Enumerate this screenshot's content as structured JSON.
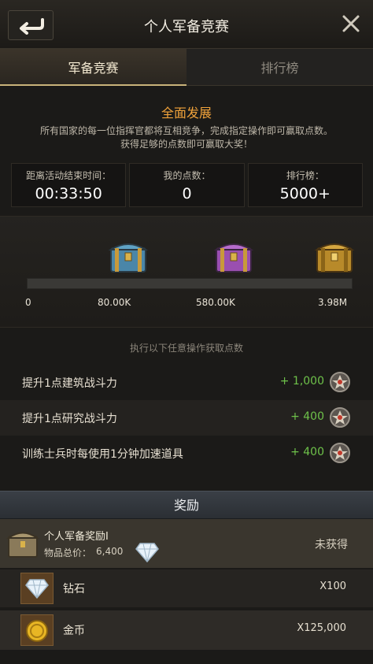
{
  "header": {
    "title": "个人军备竞赛",
    "back_icon": "back-arrow-icon",
    "close_icon": "close-icon"
  },
  "tabs": [
    {
      "label": "军备竞赛",
      "active": true
    },
    {
      "label": "排行榜",
      "active": false
    }
  ],
  "event": {
    "title": "全面发展",
    "description_line1": "所有国家的每一位指挥官都将互相竞争，完成指定操作即可赢取点数。",
    "description_line2": "获得足够的点数即可赢取大奖！"
  },
  "stats": {
    "time_label": "距离活动结束时间：",
    "time_value": "00:33:50",
    "points_label": "我的点数：",
    "points_value": "0",
    "rank_label": "排行榜：",
    "rank_value": "5000+"
  },
  "progress": {
    "fraction": 0,
    "milestones": [
      "0",
      "80.00K",
      "580.00K",
      "3.98M"
    ],
    "chests": [
      {
        "icon": "blue-chest-icon",
        "color": "#4a86a8"
      },
      {
        "icon": "purple-chest-icon",
        "color": "#9a4fb0"
      },
      {
        "icon": "gold-chest-icon",
        "color": "#b88a2a"
      }
    ]
  },
  "tasks": {
    "hint": "执行以下任意操作获取点数",
    "items": [
      {
        "label": "提升1点建筑战斗力",
        "points": "+ 1,000",
        "icon": "medal-badge-icon"
      },
      {
        "label": "提升1点研究战斗力",
        "points": "+ 400",
        "icon": "medal-badge-icon"
      },
      {
        "label": "训练士兵时每使用1分钟加速道具",
        "points": "+ 400",
        "icon": "medal-badge-icon"
      }
    ]
  },
  "rewards": {
    "header": "奖励",
    "package": {
      "name": "个人军备奖励I",
      "total_label": "物品总价：",
      "total_value": "6,400",
      "status": "未获得",
      "icon": "reward-chest-icon",
      "currency_icon": "diamond-icon"
    },
    "items": [
      {
        "name": "钻石",
        "qty": "X100",
        "icon": "diamond-icon"
      },
      {
        "name": "金币",
        "qty": "X125,000",
        "icon": "gold-coin-icon"
      }
    ]
  },
  "colors": {
    "accent": "#f0a23a",
    "positive": "#6ec24a",
    "tab_underline": "#c9b37a"
  }
}
